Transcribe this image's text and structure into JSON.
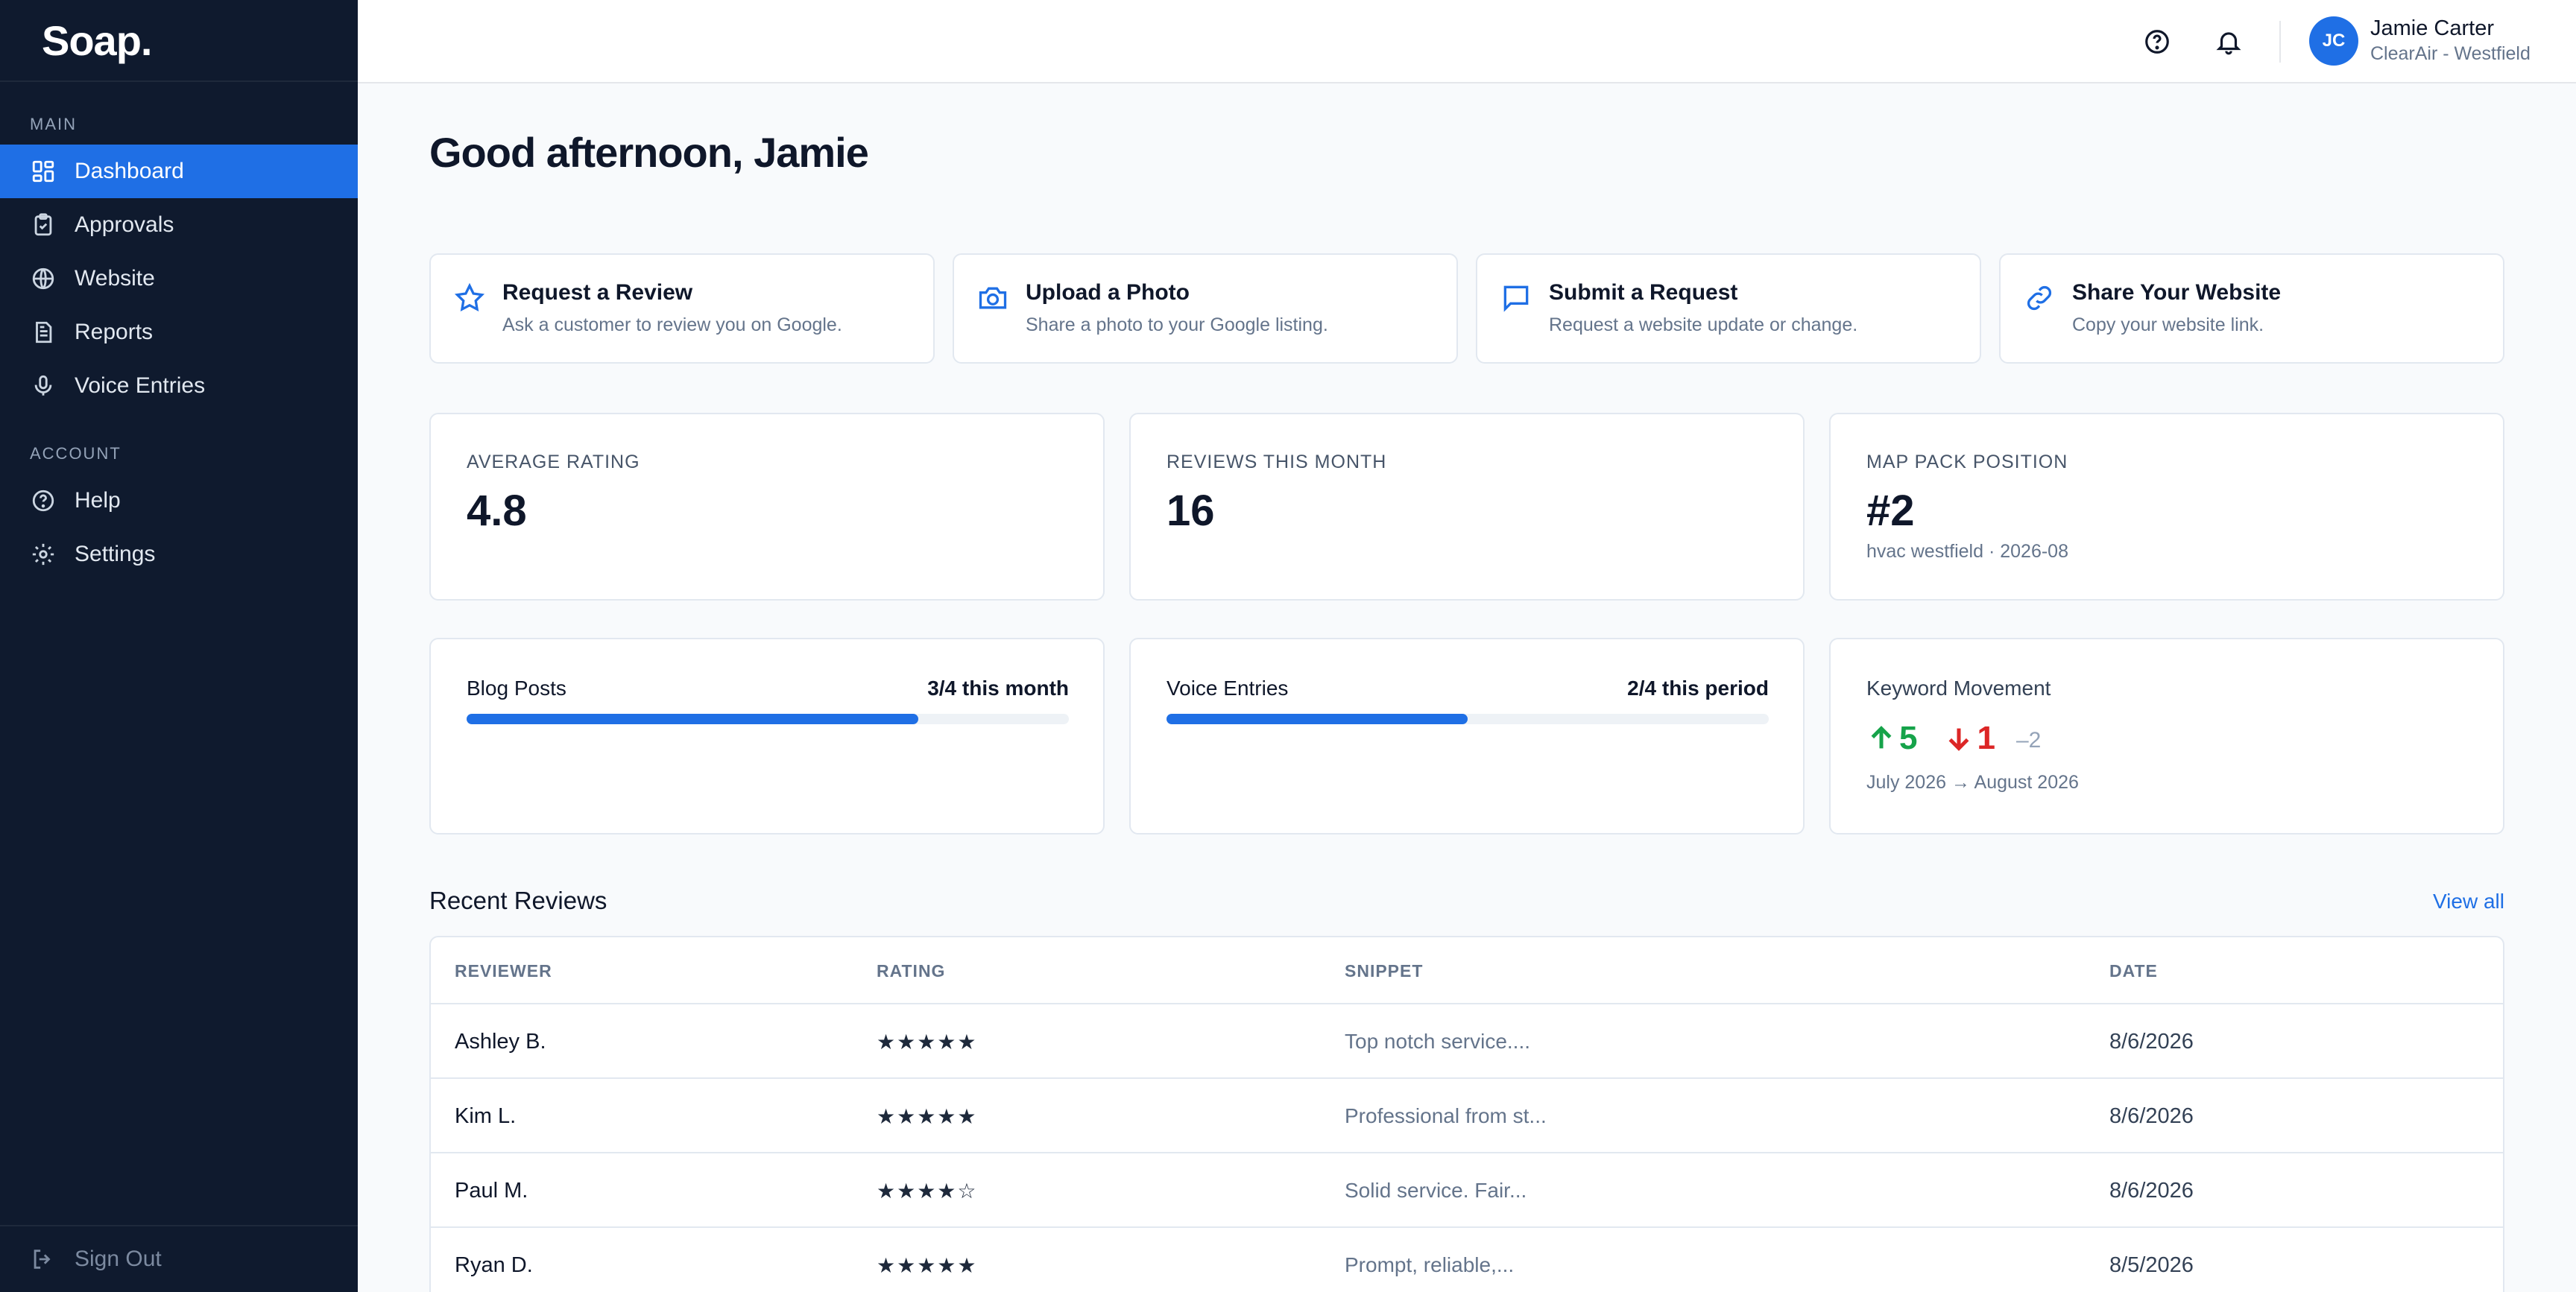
{
  "brand": {
    "logo_text": "Soap."
  },
  "sidebar": {
    "main_label": "MAIN",
    "main_items": [
      {
        "label": "Dashboard",
        "icon": "grid-icon",
        "active": true
      },
      {
        "label": "Approvals",
        "icon": "clipboard-check-icon"
      },
      {
        "label": "Website",
        "icon": "globe-icon"
      },
      {
        "label": "Reports",
        "icon": "document-icon"
      },
      {
        "label": "Voice Entries",
        "icon": "microphone-icon"
      }
    ],
    "account_label": "ACCOUNT",
    "account_items": [
      {
        "label": "Help",
        "icon": "help-circle-icon"
      },
      {
        "label": "Settings",
        "icon": "gear-icon"
      }
    ],
    "sign_out": "Sign Out"
  },
  "header": {
    "user": {
      "initials": "JC",
      "name": "Jamie Carter",
      "org": "ClearAir - Westfield"
    }
  },
  "greeting": "Good afternoon, Jamie",
  "quick_actions": [
    {
      "title": "Request a Review",
      "subtitle": "Ask a customer to review you on Google.",
      "icon": "star-icon"
    },
    {
      "title": "Upload a Photo",
      "subtitle": "Share a photo to your Google listing.",
      "icon": "camera-icon"
    },
    {
      "title": "Submit a Request",
      "subtitle": "Request a website update or change.",
      "icon": "chat-icon"
    },
    {
      "title": "Share Your Website",
      "subtitle": "Copy your website link.",
      "icon": "link-icon"
    }
  ],
  "stats": {
    "average_rating": {
      "label": "Average Rating",
      "value": "4.8"
    },
    "reviews_month": {
      "label": "Reviews This Month",
      "value": "16"
    },
    "map_pack": {
      "label": "Map Pack Position",
      "value": "#2",
      "sub": "hvac westfield · 2026-08"
    }
  },
  "progress": {
    "blog": {
      "label": "Blog Posts",
      "status": "3/4 this month",
      "fraction": 0.75
    },
    "voice": {
      "label": "Voice Entries",
      "status": "2/4 this period",
      "fraction": 0.5
    }
  },
  "keywords": {
    "label": "Keyword Movement",
    "up": "5",
    "down": "1",
    "flat": "2",
    "period": "July 2026 → August 2026",
    "colors": {
      "up": "#16a34a",
      "down": "#dc2626"
    }
  },
  "reviews": {
    "title": "Recent Reviews",
    "view_all": "View all",
    "columns": [
      "REVIEWER",
      "RATING",
      "SNIPPET",
      "DATE"
    ],
    "rows": [
      {
        "reviewer": "Ashley B.",
        "rating": "★★★★★",
        "snippet": "Top notch service....",
        "date": "8/6/2026"
      },
      {
        "reviewer": "Kim L.",
        "rating": "★★★★★",
        "snippet": "Professional from st...",
        "date": "8/6/2026"
      },
      {
        "reviewer": "Paul M.",
        "rating": "★★★★☆",
        "snippet": "Solid service. Fair...",
        "date": "8/6/2026"
      },
      {
        "reviewer": "Ryan D.",
        "rating": "★★★★★",
        "snippet": "Prompt, reliable,...",
        "date": "8/5/2026"
      }
    ]
  },
  "colors": {
    "accent": "#1f6fe5",
    "sidebar_bg": "#0f1a2e"
  }
}
